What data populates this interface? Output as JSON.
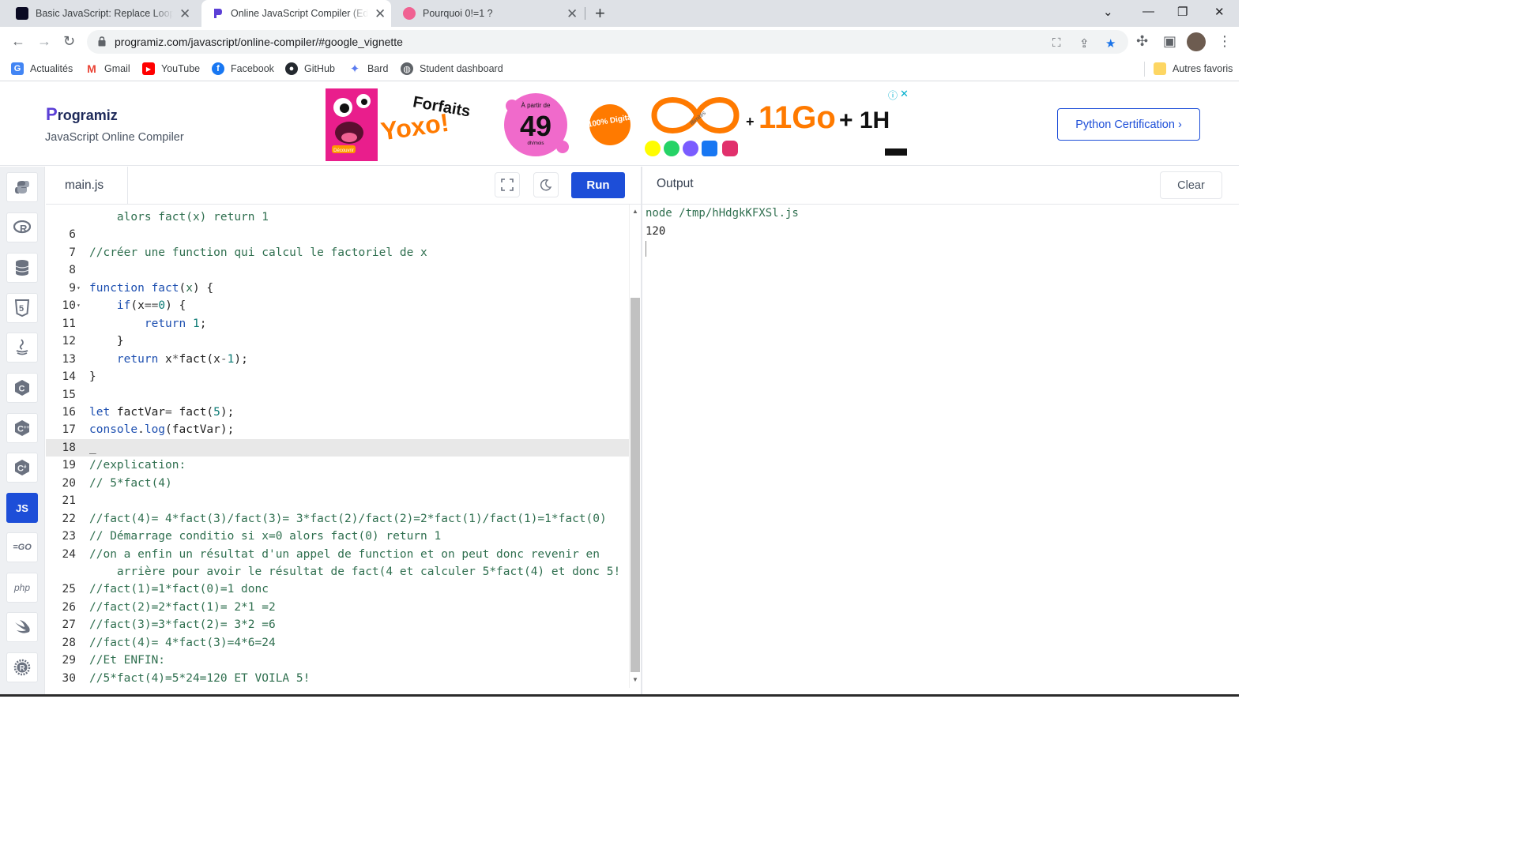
{
  "browser": {
    "tabs": [
      {
        "title": "Basic JavaScript: Replace Loops u",
        "close": "✕"
      },
      {
        "title": "Online JavaScript Compiler (Edito",
        "close": "✕"
      },
      {
        "title": "Pourquoi 0!=1 ?",
        "close": "✕"
      }
    ],
    "url": "programiz.com/javascript/online-compiler/#google_vignette",
    "bookmarks": [
      "Actualités",
      "Gmail",
      "YouTube",
      "Facebook",
      "GitHub",
      "Bard",
      "Student dashboard"
    ],
    "other_bookmarks": "Autres favoris"
  },
  "header": {
    "logo_p": "P",
    "logo_rest": "rogramiz",
    "subtitle": "JavaScript Online Compiler",
    "cert_button": "Python Certification ›"
  },
  "ad": {
    "forfaits": "Forfaits",
    "brand": "Yoxo!",
    "a_partir": "À partir de",
    "price": "49",
    "price_unit": "dh/mois",
    "digital": "100% Digital",
    "illimites": "Illimités",
    "offer_plus": "+",
    "offer_go": "11Go",
    "offer_h": "+ 1H",
    "decouvrir": "Découvrir"
  },
  "editor": {
    "file_name": "main.js",
    "run_label": "Run",
    "lines": [
      {
        "n": "",
        "segs": [
          [
            "cm",
            "    alors fact(x) return 1"
          ]
        ]
      },
      {
        "n": "6",
        "segs": []
      },
      {
        "n": "7",
        "segs": [
          [
            "cm",
            "//créer une function qui calcul le factoriel de x"
          ]
        ]
      },
      {
        "n": "8",
        "segs": []
      },
      {
        "n": "9",
        "fold": true,
        "segs": [
          [
            "kw",
            "function "
          ],
          [
            "fn",
            "fact"
          ],
          [
            "pl",
            "("
          ],
          [
            "cm",
            "x"
          ],
          [
            "pl",
            ") {"
          ]
        ]
      },
      {
        "n": "10",
        "fold": true,
        "segs": [
          [
            "pl",
            "    "
          ],
          [
            "kw",
            "if"
          ],
          [
            "pl",
            "("
          ],
          [
            "pl",
            "x"
          ],
          [
            "op",
            "=="
          ],
          [
            "num",
            "0"
          ],
          [
            "pl",
            ") {"
          ]
        ]
      },
      {
        "n": "11",
        "segs": [
          [
            "pl",
            "        "
          ],
          [
            "kw",
            "return "
          ],
          [
            "num",
            "1"
          ],
          [
            "pl",
            ";"
          ]
        ]
      },
      {
        "n": "12",
        "segs": [
          [
            "pl",
            "    }"
          ]
        ]
      },
      {
        "n": "13",
        "segs": [
          [
            "pl",
            "    "
          ],
          [
            "kw",
            "return "
          ],
          [
            "pl",
            "x"
          ],
          [
            "op",
            "*"
          ],
          [
            "pl",
            "fact(x"
          ],
          [
            "op",
            "-"
          ],
          [
            "num",
            "1"
          ],
          [
            "pl",
            ");"
          ]
        ]
      },
      {
        "n": "14",
        "segs": [
          [
            "pl",
            "}"
          ]
        ]
      },
      {
        "n": "15",
        "segs": []
      },
      {
        "n": "16",
        "segs": [
          [
            "kw",
            "let "
          ],
          [
            "pl",
            "factVar"
          ],
          [
            "op",
            "= "
          ],
          [
            "pl",
            "fact("
          ],
          [
            "num",
            "5"
          ],
          [
            "pl",
            ");"
          ]
        ]
      },
      {
        "n": "17",
        "segs": [
          [
            "kw",
            "console"
          ],
          [
            "pl",
            "."
          ],
          [
            "kw",
            "log"
          ],
          [
            "pl",
            "(factVar);"
          ]
        ]
      },
      {
        "n": "18",
        "active": true,
        "segs": [
          [
            "pl",
            "_"
          ]
        ]
      },
      {
        "n": "19",
        "segs": [
          [
            "cm",
            "//explication:"
          ]
        ]
      },
      {
        "n": "20",
        "segs": [
          [
            "cm",
            "// 5*fact(4)"
          ]
        ]
      },
      {
        "n": "21",
        "segs": []
      },
      {
        "n": "22",
        "segs": [
          [
            "cm",
            "//fact(4)= 4*fact(3)/fact(3)= 3*fact(2)/fact(2)=2*fact(1)/fact(1)=1*fact(0)"
          ]
        ]
      },
      {
        "n": "23",
        "segs": [
          [
            "cm",
            "// Démarrage conditio si x=0 alors fact(0) return 1"
          ]
        ]
      },
      {
        "n": "24",
        "segs": [
          [
            "cm",
            "//on a enfin un résultat d'un appel de function et on peut donc revenir en"
          ]
        ]
      },
      {
        "n": "",
        "segs": [
          [
            "cm",
            "    arrière pour avoir le résultat de fact(4 et calculer 5*fact(4) et donc 5!"
          ]
        ]
      },
      {
        "n": "25",
        "segs": [
          [
            "cm",
            "//fact(1)=1*fact(0)=1 donc"
          ]
        ]
      },
      {
        "n": "26",
        "segs": [
          [
            "cm",
            "//fact(2)=2*fact(1)= 2*1 =2"
          ]
        ]
      },
      {
        "n": "27",
        "segs": [
          [
            "cm",
            "//fact(3)=3*fact(2)= 3*2 =6"
          ]
        ]
      },
      {
        "n": "28",
        "segs": [
          [
            "cm",
            "//fact(4)= 4*fact(3)=4*6=24"
          ]
        ]
      },
      {
        "n": "29",
        "segs": [
          [
            "cm",
            "//Et ENFIN:"
          ]
        ]
      },
      {
        "n": "30",
        "segs": [
          [
            "cm",
            "//5*fact(4)=5*24=120 ET VOILA 5!"
          ]
        ]
      }
    ]
  },
  "output": {
    "title": "Output",
    "clear_label": "Clear",
    "command": "node /tmp/hHdgkKFXSl.js",
    "result": "120"
  },
  "sidebar": {
    "languages": [
      {
        "name": "python-icon",
        "glyph": "🐍"
      },
      {
        "name": "r-icon",
        "glyph": "R"
      },
      {
        "name": "sql-icon",
        "glyph": "≣"
      },
      {
        "name": "html-icon",
        "glyph": "5"
      },
      {
        "name": "java-icon",
        "glyph": "☕"
      },
      {
        "name": "c-icon",
        "glyph": "C"
      },
      {
        "name": "cpp-icon",
        "glyph": "C"
      },
      {
        "name": "csharp-icon",
        "glyph": "C"
      },
      {
        "name": "js-icon",
        "glyph": "JS",
        "active": true
      },
      {
        "name": "go-icon",
        "glyph": "GO"
      },
      {
        "name": "php-icon",
        "glyph": "php"
      },
      {
        "name": "swift-icon",
        "glyph": "➶"
      },
      {
        "name": "rust-icon",
        "glyph": "R"
      }
    ]
  },
  "colors": {
    "accent": "#1d4ed8",
    "comment": "#2f6f4f",
    "keyword": "#1d4fb0",
    "number": "#0b7a74"
  }
}
